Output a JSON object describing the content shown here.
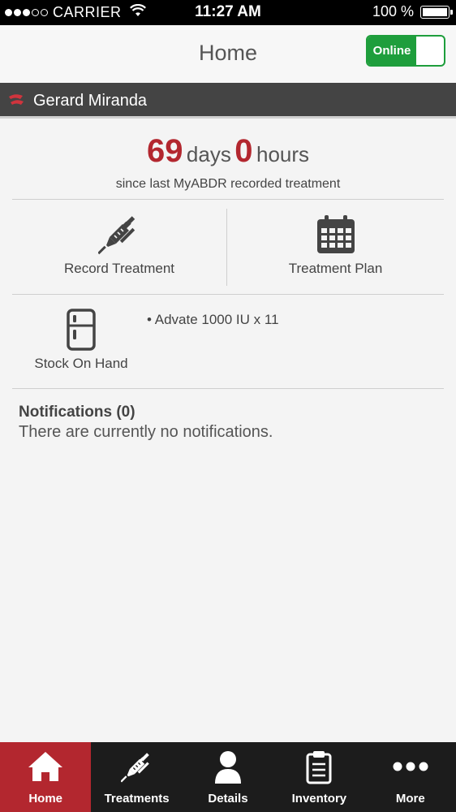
{
  "status_bar": {
    "carrier": "CARRIER",
    "time": "11:27 AM",
    "battery": "100 %"
  },
  "header": {
    "title": "Home",
    "online_label": "Online"
  },
  "user": {
    "name": "Gerard Miranda"
  },
  "since_treatment": {
    "days": "69",
    "days_unit": "days",
    "hours": "0",
    "hours_unit": "hours",
    "caption": "since last MyABDR recorded treatment"
  },
  "actions": {
    "record_treatment": "Record Treatment",
    "treatment_plan": "Treatment Plan",
    "stock_on_hand": "Stock On Hand"
  },
  "stock": {
    "items": [
      "• Advate 1000 IU x 11"
    ]
  },
  "notifications": {
    "title": "Notifications (0)",
    "text": "There are currently no notifications."
  },
  "tabs": [
    {
      "label": "Home",
      "icon": "home-icon"
    },
    {
      "label": "Treatments",
      "icon": "syringe-icon"
    },
    {
      "label": "Details",
      "icon": "person-icon"
    },
    {
      "label": "Inventory",
      "icon": "clipboard-icon"
    },
    {
      "label": "More",
      "icon": "more-dots-icon"
    }
  ],
  "colors": {
    "accent": "#b3272f",
    "online": "#1e9e3c",
    "tab_bar": "#1c1c1c"
  }
}
